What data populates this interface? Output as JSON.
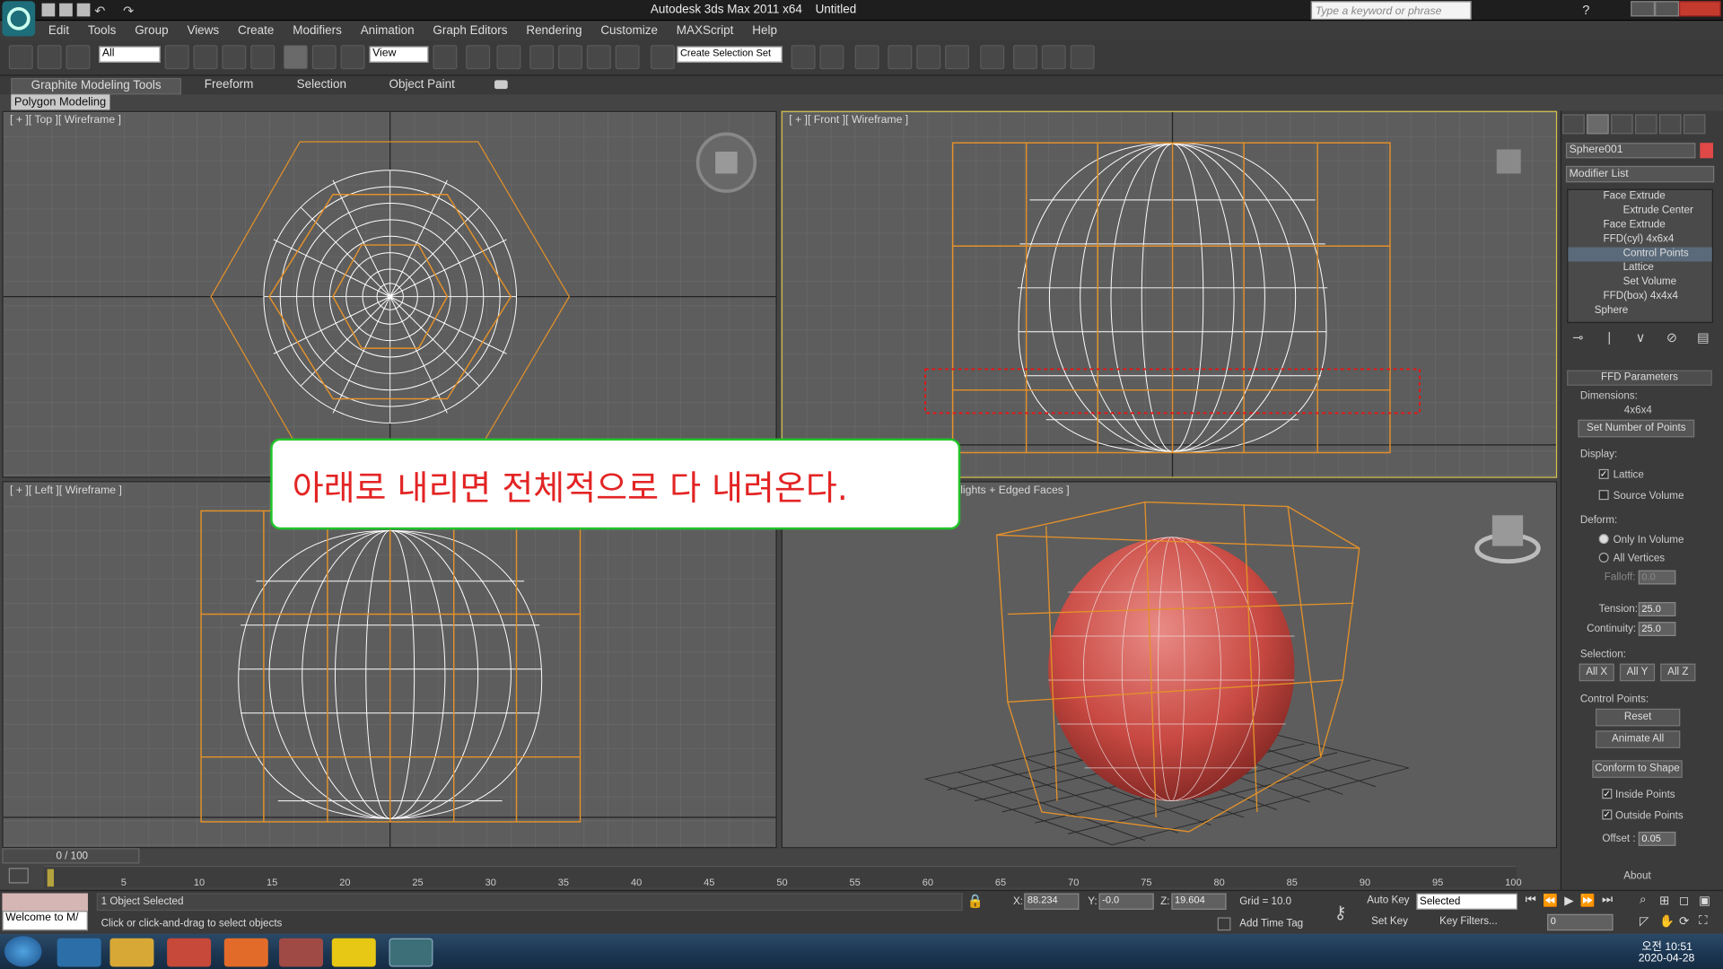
{
  "window": {
    "title": "Autodesk 3ds Max  2011 x64",
    "document": "Untitled",
    "search_placeholder": "Type a keyword or phrase"
  },
  "menu": [
    "Edit",
    "Tools",
    "Group",
    "Views",
    "Create",
    "Modifiers",
    "Animation",
    "Graph Editors",
    "Rendering",
    "Customize",
    "MAXScript",
    "Help"
  ],
  "toolbar": {
    "selection_filter": "All",
    "ref_coord": "View",
    "named_selection": "Create Selection Set"
  },
  "ribbon": {
    "tabs": [
      "Graphite Modeling Tools",
      "Freeform",
      "Selection",
      "Object Paint"
    ],
    "subtab": "Polygon Modeling"
  },
  "viewports": {
    "top": "[ + ][ Top ][ Wireframe ]",
    "front": "[ + ][ Front ][ Wireframe ]",
    "left": "[ + ][ Left ][ Wireframe ]",
    "persp": "lights + Edged Faces ]"
  },
  "callout": {
    "text": "아래로 내리면 전체적으로 다 내려온다."
  },
  "command_panel": {
    "object_name": "Sphere001",
    "modifier_list": "Modifier List",
    "stack": [
      "Face Extrude",
      "Extrude Center",
      "Face Extrude",
      "FFD(cyl) 4x6x4",
      "Control Points",
      "Lattice",
      "Set Volume",
      "FFD(box) 4x4x4",
      "Sphere"
    ],
    "rollout_title": "FFD Parameters",
    "dimensions_label": "Dimensions:",
    "dimensions": "4x6x4",
    "set_points": "Set Number of Points",
    "display_label": "Display:",
    "lattice": "Lattice",
    "source_volume": "Source Volume",
    "deform_label": "Deform:",
    "only_in_volume": "Only In Volume",
    "all_vertices": "All Vertices",
    "falloff_label": "Falloff:",
    "falloff": "0.0",
    "tension_label": "Tension:",
    "tension": "25.0",
    "continuity_label": "Continuity:",
    "continuity": "25.0",
    "selection_label": "Selection:",
    "allx": "All X",
    "ally": "All Y",
    "allz": "All Z",
    "cp_label": "Control Points:",
    "reset": "Reset",
    "animate_all": "Animate All",
    "conform": "Conform to Shape",
    "inside_points": "Inside Points",
    "outside_points": "Outside Points",
    "offset_label": "Offset :",
    "offset": "0.05",
    "about": "About"
  },
  "timeline": {
    "frame": "0 / 100",
    "ticks": [
      "5",
      "10",
      "15",
      "20",
      "25",
      "30",
      "35",
      "40",
      "45",
      "50",
      "55",
      "60",
      "65",
      "70",
      "75",
      "80",
      "85",
      "90",
      "95",
      "100"
    ]
  },
  "status": {
    "maxscript": "Welcome to M/",
    "selected": "1 Object Selected",
    "prompt": "Click or click-and-drag to select objects",
    "x_label": "X:",
    "x": "88.234",
    "y_label": "Y:",
    "y": "-0.0",
    "z_label": "Z:",
    "z": "19.604",
    "grid": "Grid = 10.0",
    "auto_key": "Auto Key",
    "set_key": "Set Key",
    "selected_dd": "Selected",
    "key_filters": "Key Filters...",
    "add_time_tag": "Add Time Tag",
    "frame_field": "0"
  },
  "taskbar": {
    "time": "오전 10:51",
    "date": "2020-04-28"
  }
}
